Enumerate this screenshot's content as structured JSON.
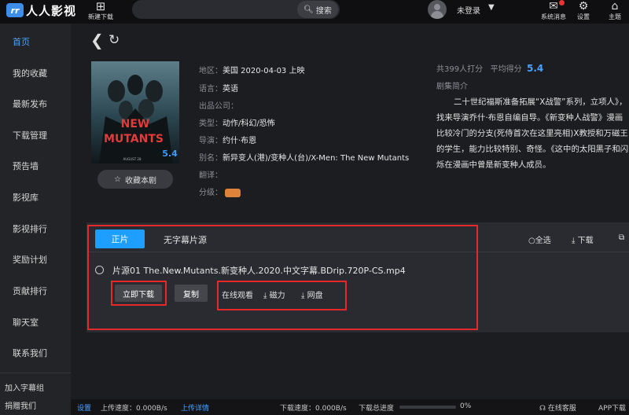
{
  "app": {
    "logo_text": "人人影视",
    "logo_badge": "rr"
  },
  "topbar": {
    "new_download_label": "新建下载",
    "search_label": "搜索",
    "search_placeholder": "",
    "login_status": "未登录",
    "system_message_label": "系统消息",
    "settings_label": "设置",
    "theme_label": "主题"
  },
  "sidebar": {
    "items": [
      {
        "label": "首页"
      },
      {
        "label": "我的收藏"
      },
      {
        "label": "最新发布"
      },
      {
        "label": "下载管理"
      },
      {
        "label": "预告墙"
      },
      {
        "label": "影视库"
      },
      {
        "label": "影视排行"
      },
      {
        "label": "奖励计划"
      },
      {
        "label": "贡献排行"
      },
      {
        "label": "聊天室"
      },
      {
        "label": "联系我们"
      }
    ],
    "join_subtitle_group": "加入字幕组",
    "donate": "捐赠我们"
  },
  "movie": {
    "poster_title_line1": "NEW",
    "poster_title_line2": "MUTANTS",
    "poster_score": "5.4",
    "poster_bottom_text": "AUGUST 28",
    "collect_label": "收藏本剧",
    "region_label": "地区：",
    "region_value": "美国  2020-04-03  上映",
    "language_label": "语言：",
    "language_value": "英语",
    "company_label": "出品公司：",
    "company_value": "",
    "genre_label": "类型：",
    "genre_value": "动作/科幻/恐怖",
    "director_label": "导演：",
    "director_value": "约什·布恩",
    "alias_label": "别名：",
    "alias_value": "新异变人(港)/变种人(台)/X-Men: The New Mutants",
    "translator_label": "翻译：",
    "translator_value": "",
    "rating_label": "分级：",
    "rating_count_text": "共399人打分",
    "avg_label": "平均得分",
    "avg_score": "5.4",
    "synopsis_title": "剧集简介",
    "synopsis": "二十世纪福斯准备拓展“X战警”系列，立项人》，找来导演乔什·布恩自编自导。《新变种人战警》漫画比较冷门的分支(死侍首次在这里亮相)X教授和万磁王的学生，能力比较特别、奇怪。《这中的太阳黑子和闪烁在漫画中曾是新变种人成员。"
  },
  "sources": {
    "tab_main": "正片",
    "tab_nosub": "无字幕片源",
    "select_all": "全选",
    "download_all": "下载",
    "source_name": "片源01   The.New.Mutants.新变种人.2020.中文字幕.BDrip.720P-CS.mp4",
    "download_now": "立即下载",
    "copy": "复制",
    "online_watch": "在线观看",
    "magnet": "磁力",
    "netdisk": "网盘"
  },
  "statusbar": {
    "settings": "设置",
    "upload_speed": "上传速度：0.000B/s",
    "upload_detail": "上传详情",
    "download_speed": "下载速度：0.000B/s",
    "total_progress_label": "下载总进度",
    "total_progress_value": "0%",
    "total_progress_fraction": 0,
    "online_service": "在线客服",
    "app_download": "APP下载"
  },
  "colors": {
    "accent": "#1e9eff",
    "highlight_box": "#e5282a",
    "background": "#1c1d21"
  }
}
